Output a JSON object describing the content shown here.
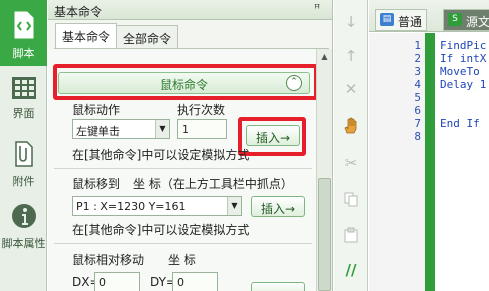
{
  "sidebar": {
    "items": [
      {
        "label": "脚本",
        "icon": "script-icon"
      },
      {
        "label": "界面",
        "icon": "grid-icon"
      },
      {
        "label": "附件",
        "icon": "paperclip-icon"
      },
      {
        "label": "脚本属性",
        "icon": "info-icon"
      }
    ]
  },
  "panel": {
    "title": "基本命令",
    "pin": "ꟸ",
    "tabs": [
      "基本命令",
      "全部命令"
    ]
  },
  "mouse_section": {
    "title": "鼠标命令",
    "collapse": "⌃"
  },
  "mouse_action": {
    "action_label": "鼠标动作",
    "count_label": "执行次数",
    "action_value": "左键单击",
    "count_value": "1",
    "insert_label": "插入→",
    "hint": "在[其他命令]中可以设定模拟方式"
  },
  "mouse_move": {
    "label": "鼠标移到",
    "coord_label": "坐 标（在上方工具栏中抓点）",
    "point_value": "P1 : X=1230 Y=161",
    "insert_label": "插入→",
    "hint": "在[其他命令]中可以设定模拟方式"
  },
  "mouse_relative": {
    "label": "鼠标相对移动",
    "coord_label": "坐 标",
    "dx_label": "DX=",
    "dx_value": "0",
    "dy_label": "DY=",
    "dy_value": "0"
  },
  "editor": {
    "tabs": [
      "普通",
      "源文"
    ],
    "line_numbers": [
      "1",
      "2",
      "3",
      "4",
      "5",
      "6",
      "7",
      "8"
    ],
    "code_lines": [
      "FindPic",
      "If intX",
      "MoveTo",
      "Delay 1",
      "",
      "",
      "End If",
      ""
    ]
  },
  "colors": {
    "accent_green": "#3aa845",
    "highlight_red": "#e5202a"
  }
}
